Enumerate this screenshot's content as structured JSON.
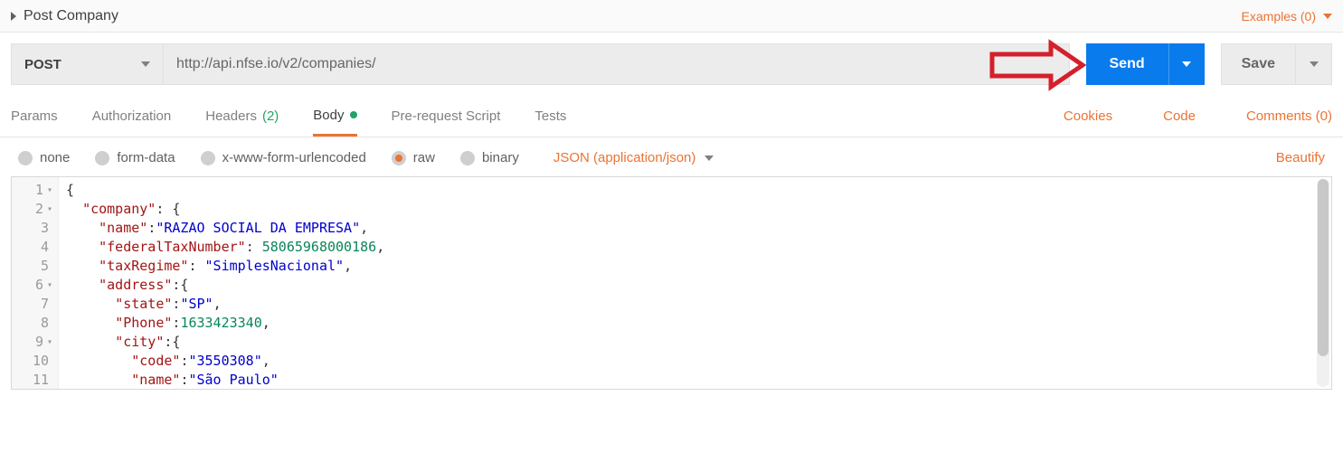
{
  "header": {
    "title": "Post Company",
    "examples_label": "Examples (0)"
  },
  "request": {
    "method": "POST",
    "url": "http://api.nfse.io/v2/companies/",
    "send_label": "Send",
    "save_label": "Save"
  },
  "tabs": {
    "params": "Params",
    "authorization": "Authorization",
    "headers_label": "Headers",
    "headers_count": "(2)",
    "body": "Body",
    "prerequest": "Pre-request Script",
    "tests": "Tests",
    "cookies": "Cookies",
    "code": "Code",
    "comments": "Comments (0)"
  },
  "body_types": {
    "none": "none",
    "formdata": "form-data",
    "xwww": "x-www-form-urlencoded",
    "raw": "raw",
    "binary": "binary",
    "content_type": "JSON (application/json)",
    "beautify": "Beautify"
  },
  "editor": {
    "lines": [
      {
        "num": "1",
        "fold": true,
        "indent": 0,
        "tokens": [
          {
            "t": "punc",
            "v": "{"
          }
        ]
      },
      {
        "num": "2",
        "fold": true,
        "indent": 1,
        "tokens": [
          {
            "t": "key",
            "v": "\"company\""
          },
          {
            "t": "punc",
            "v": ": {"
          }
        ]
      },
      {
        "num": "3",
        "fold": false,
        "indent": 2,
        "tokens": [
          {
            "t": "key",
            "v": "\"name\""
          },
          {
            "t": "punc",
            "v": ":"
          },
          {
            "t": "str",
            "v": "\"RAZAO SOCIAL DA EMPRESA\""
          },
          {
            "t": "punc",
            "v": ","
          }
        ]
      },
      {
        "num": "4",
        "fold": false,
        "indent": 2,
        "tokens": [
          {
            "t": "key",
            "v": "\"federalTaxNumber\""
          },
          {
            "t": "punc",
            "v": ": "
          },
          {
            "t": "num",
            "v": "58065968000186"
          },
          {
            "t": "punc",
            "v": ","
          }
        ]
      },
      {
        "num": "5",
        "fold": false,
        "indent": 2,
        "tokens": [
          {
            "t": "key",
            "v": "\"taxRegime\""
          },
          {
            "t": "punc",
            "v": ": "
          },
          {
            "t": "str",
            "v": "\"SimplesNacional\""
          },
          {
            "t": "punc",
            "v": ","
          }
        ]
      },
      {
        "num": "6",
        "fold": true,
        "indent": 2,
        "tokens": [
          {
            "t": "key",
            "v": "\"address\""
          },
          {
            "t": "punc",
            "v": ":{"
          }
        ]
      },
      {
        "num": "7",
        "fold": false,
        "indent": 3,
        "tokens": [
          {
            "t": "key",
            "v": "\"state\""
          },
          {
            "t": "punc",
            "v": ":"
          },
          {
            "t": "str",
            "v": "\"SP\""
          },
          {
            "t": "punc",
            "v": ","
          }
        ]
      },
      {
        "num": "8",
        "fold": false,
        "indent": 3,
        "tokens": [
          {
            "t": "key",
            "v": "\"Phone\""
          },
          {
            "t": "punc",
            "v": ":"
          },
          {
            "t": "num",
            "v": "1633423340"
          },
          {
            "t": "punc",
            "v": ","
          }
        ]
      },
      {
        "num": "9",
        "fold": true,
        "indent": 3,
        "tokens": [
          {
            "t": "key",
            "v": "\"city\""
          },
          {
            "t": "punc",
            "v": ":{"
          }
        ]
      },
      {
        "num": "10",
        "fold": false,
        "indent": 4,
        "tokens": [
          {
            "t": "key",
            "v": "\"code\""
          },
          {
            "t": "punc",
            "v": ":"
          },
          {
            "t": "str",
            "v": "\"3550308\""
          },
          {
            "t": "punc",
            "v": ","
          }
        ]
      },
      {
        "num": "11",
        "fold": false,
        "indent": 4,
        "tokens": [
          {
            "t": "key",
            "v": "\"name\""
          },
          {
            "t": "punc",
            "v": ":"
          },
          {
            "t": "str",
            "v": "\"São Paulo\""
          }
        ]
      }
    ]
  }
}
